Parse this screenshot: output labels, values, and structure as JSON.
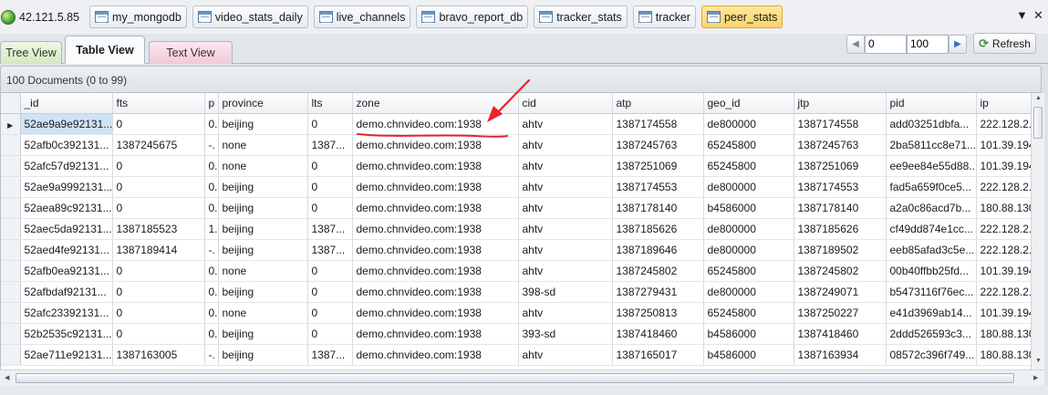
{
  "breadcrumbs": [
    {
      "label": "42.121.5.85",
      "kind": "server"
    },
    {
      "label": "my_mongodb",
      "kind": "db"
    },
    {
      "label": "video_stats_daily",
      "kind": "collection"
    },
    {
      "label": "live_channels",
      "kind": "collection"
    },
    {
      "label": "bravo_report_db",
      "kind": "db"
    },
    {
      "label": "tracker_stats",
      "kind": "collection"
    },
    {
      "label": "tracker",
      "kind": "db"
    },
    {
      "label": "peer_stats",
      "kind": "collection",
      "active": true
    }
  ],
  "window_controls": {
    "dropdown": "▼",
    "close": "✕"
  },
  "tabs": [
    {
      "label": "Tree View"
    },
    {
      "label": "Table View",
      "active": true
    },
    {
      "label": "Text View"
    }
  ],
  "pager": {
    "skip": "0",
    "limit": "100",
    "refresh_label": "Refresh"
  },
  "doc_count": "100 Documents (0 to 99)",
  "table": {
    "columns": [
      "_id",
      "fts",
      "p",
      "province",
      "lts",
      "zone",
      "cid",
      "atp",
      "geo_id",
      "jtp",
      "pid",
      "ip"
    ],
    "rows": [
      [
        "52ae9a9e92131...",
        "0",
        "0.",
        "beijing",
        "0",
        "demo.chnvideo.com:1938",
        "ahtv",
        "1387174558",
        "de800000",
        "1387174558",
        "add03251dbfa...",
        "222.128.2."
      ],
      [
        "52afb0c392131...",
        "1387245675",
        "-.",
        "none",
        "1387...",
        "demo.chnvideo.com:1938",
        "ahtv",
        "1387245763",
        "65245800",
        "1387245763",
        "2ba5811cc8e71...",
        "101.39.194"
      ],
      [
        "52afc57d92131...",
        "0",
        "0.",
        "none",
        "0",
        "demo.chnvideo.com:1938",
        "ahtv",
        "1387251069",
        "65245800",
        "1387251069",
        "ee9ee84e55d88...",
        "101.39.194"
      ],
      [
        "52ae9a9992131...",
        "0",
        "0.",
        "beijing",
        "0",
        "demo.chnvideo.com:1938",
        "ahtv",
        "1387174553",
        "de800000",
        "1387174553",
        "fad5a659f0ce5...",
        "222.128.2."
      ],
      [
        "52aea89c92131...",
        "0",
        "0.",
        "beijing",
        "0",
        "demo.chnvideo.com:1938",
        "ahtv",
        "1387178140",
        "b4586000",
        "1387178140",
        "a2a0c86acd7b...",
        "180.88.130"
      ],
      [
        "52aec5da92131...",
        "1387185523",
        "1.",
        "beijing",
        "1387...",
        "demo.chnvideo.com:1938",
        "ahtv",
        "1387185626",
        "de800000",
        "1387185626",
        "cf49dd874e1cc...",
        "222.128.2."
      ],
      [
        "52aed4fe92131...",
        "1387189414",
        "-.",
        "beijing",
        "1387...",
        "demo.chnvideo.com:1938",
        "ahtv",
        "1387189646",
        "de800000",
        "1387189502",
        "eeb85afad3c5e...",
        "222.128.2."
      ],
      [
        "52afb0ea92131...",
        "0",
        "0.",
        "none",
        "0",
        "demo.chnvideo.com:1938",
        "ahtv",
        "1387245802",
        "65245800",
        "1387245802",
        "00b40ffbb25fd...",
        "101.39.194"
      ],
      [
        "52afbdaf92131...",
        "0",
        "0.",
        "beijing",
        "0",
        "demo.chnvideo.com:1938",
        "398-sd",
        "1387279431",
        "de800000",
        "1387249071",
        "b5473116f76ec...",
        "222.128.2."
      ],
      [
        "52afc23392131...",
        "0",
        "0.",
        "none",
        "0",
        "demo.chnvideo.com:1938",
        "ahtv",
        "1387250813",
        "65245800",
        "1387250227",
        "e41d3969ab14...",
        "101.39.194"
      ],
      [
        "52b2535c92131...",
        "0",
        "0.",
        "beijing",
        "0",
        "demo.chnvideo.com:1938",
        "393-sd",
        "1387418460",
        "b4586000",
        "1387418460",
        "2ddd526593c3...",
        "180.88.130"
      ],
      [
        "52ae711e92131...",
        "1387163005",
        "-.",
        "beijing",
        "1387...",
        "demo.chnvideo.com:1938",
        "ahtv",
        "1387165017",
        "b4586000",
        "1387163934",
        "08572c396f749...",
        "180.88.130"
      ]
    ]
  },
  "colors": {
    "annotation": "#e8232a",
    "selection": "#cfe2f7",
    "active_crumb": "#fbd56a"
  }
}
